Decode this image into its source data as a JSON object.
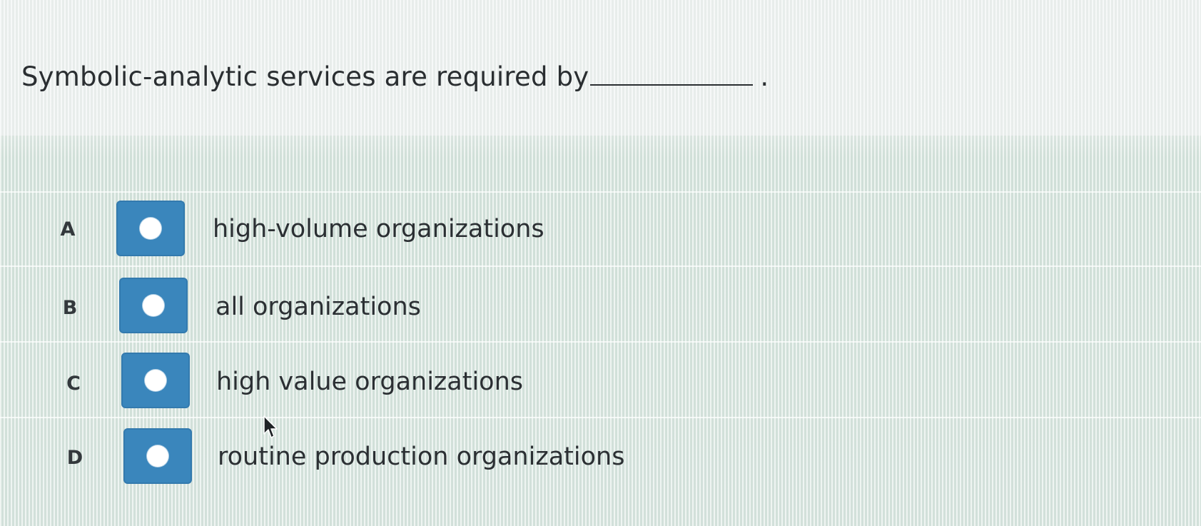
{
  "question": {
    "text": "Symbolic-analytic services are required by",
    "period": "."
  },
  "options": [
    {
      "letter": "A",
      "text": "high-volume organizations"
    },
    {
      "letter": "B",
      "text": "all organizations"
    },
    {
      "letter": "C",
      "text": "high value organizations"
    },
    {
      "letter": "D",
      "text": "routine production organizations"
    }
  ],
  "colors": {
    "radio_box": "#3a86bc",
    "radio_dot": "#ffffff",
    "text": "#2b2f33"
  },
  "icons": {
    "cursor": "mouse-pointer-icon"
  }
}
